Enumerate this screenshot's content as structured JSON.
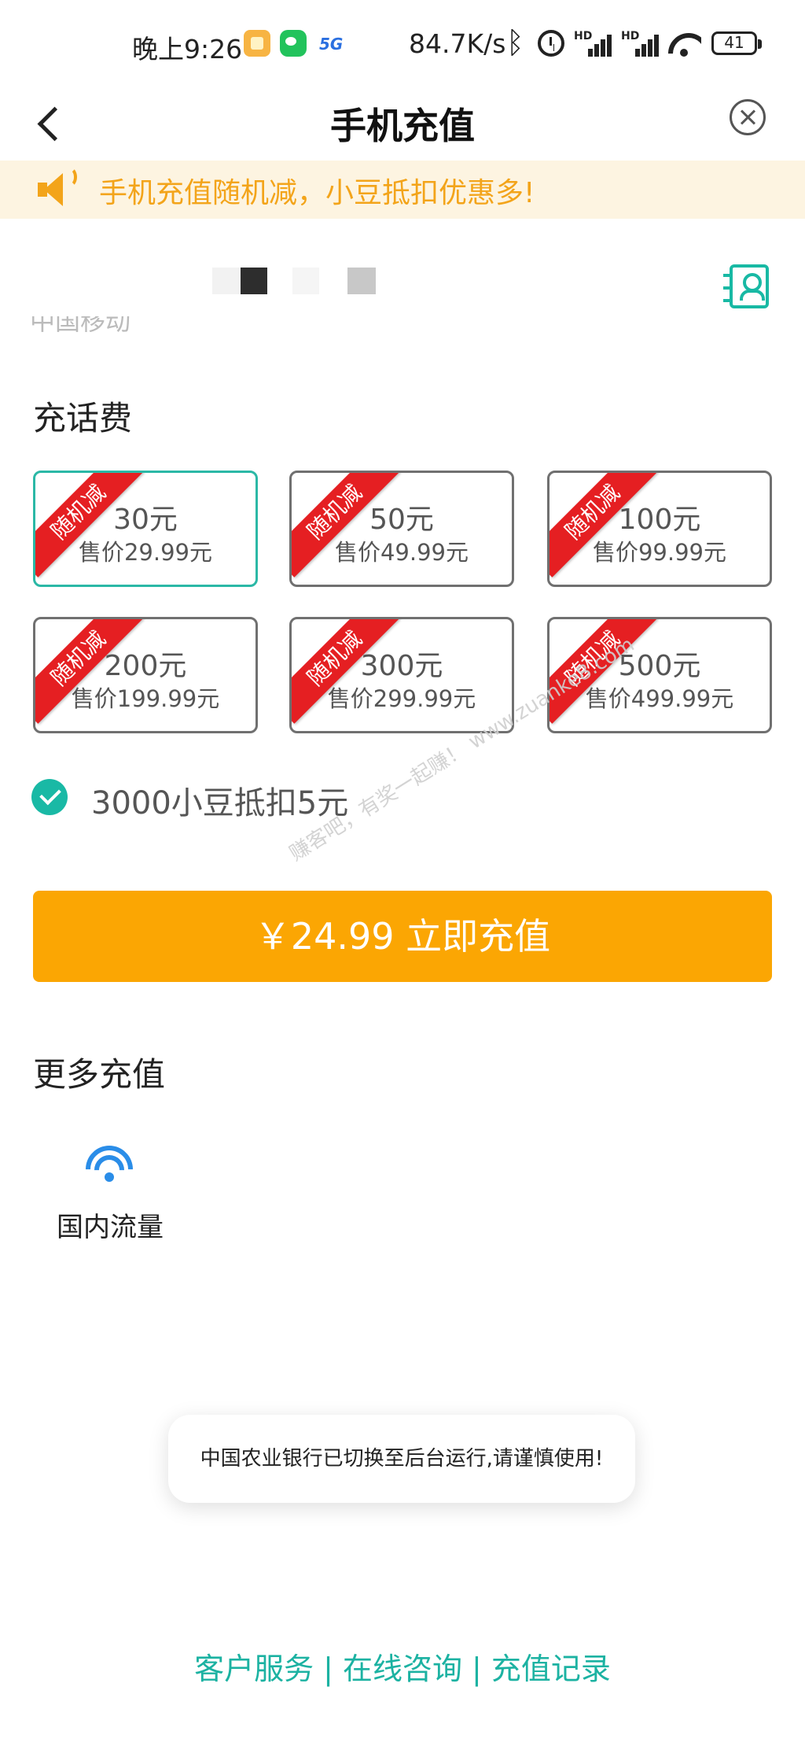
{
  "status_bar": {
    "time": "晚上9:26",
    "network_badge": "5G",
    "speed": "84.7K/s",
    "signal_label_1": "HD",
    "signal_label_2": "HD",
    "battery": "41"
  },
  "header": {
    "title": "手机充值"
  },
  "notice": {
    "text": "手机充值随机减，小豆抵扣优惠多!"
  },
  "phone": {
    "operator": "中国移动"
  },
  "topup": {
    "section_title": "充话费",
    "ribbon_label": "随机减",
    "options": [
      {
        "face": "30元",
        "price": "售价29.99元",
        "selected": true
      },
      {
        "face": "50元",
        "price": "售价49.99元",
        "selected": false
      },
      {
        "face": "100元",
        "price": "售价99.99元",
        "selected": false
      },
      {
        "face": "200元",
        "price": "售价199.99元",
        "selected": false
      },
      {
        "face": "300元",
        "price": "售价299.99元",
        "selected": false
      },
      {
        "face": "500元",
        "price": "售价499.99元",
        "selected": false
      }
    ]
  },
  "deduction": {
    "checked": true,
    "text": "3000小豆抵扣5元"
  },
  "watermark": "赚客吧，有奖一起赚！ www.zuanke8.com",
  "pay_button": {
    "label": "￥24.99 立即充值"
  },
  "more": {
    "section_title": "更多充值",
    "items": [
      {
        "label": "国内流量",
        "icon": "wifi-icon"
      }
    ]
  },
  "toast": {
    "text": "中国农业银行已切换至后台运行,请谨慎使用!"
  },
  "footer": {
    "links": [
      "客户服务",
      "在线咨询",
      "充值记录"
    ],
    "separator": "|"
  },
  "colors": {
    "accent": "#19b9a5",
    "button": "#fba603",
    "notice_text": "#f3a41a",
    "ribbon": "#e51f22",
    "wifi": "#2a8de8"
  }
}
